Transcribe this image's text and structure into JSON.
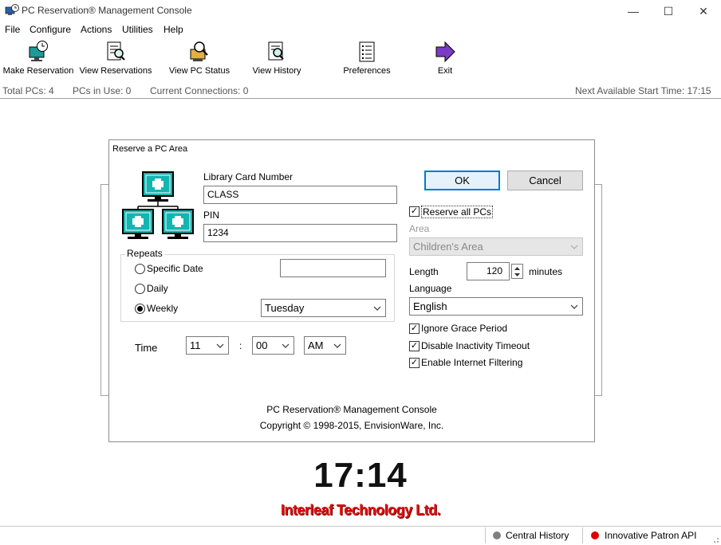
{
  "window": {
    "title": "PC Reservation® Management Console",
    "controls": {
      "minimize": "—",
      "maximize": "☐",
      "close": "✕"
    }
  },
  "menu": [
    "File",
    "Configure",
    "Actions",
    "Utilities",
    "Help"
  ],
  "toolbar": [
    {
      "label": "Make Reservation",
      "icon": "clock-computer-icon"
    },
    {
      "label": "View Reservations",
      "icon": "document-magnifier-icon"
    },
    {
      "label": "View PC Status",
      "icon": "computer-magnifier-icon"
    },
    {
      "label": "View History",
      "icon": "history-document-icon"
    },
    {
      "label": "Preferences",
      "icon": "list-document-icon"
    },
    {
      "label": "Exit",
      "icon": "exit-arrow-icon"
    }
  ],
  "status": {
    "total_pcs": "Total PCs: 4",
    "pcs_in_use": "PCs in Use: 0",
    "current_connections": "Current Connections: 0",
    "next_available": "Next Available Start Time: 17:15"
  },
  "dialog": {
    "title": "Reserve a PC Area",
    "card_label": "Library Card Number",
    "card_value": "CLASS",
    "pin_label": "PIN",
    "pin_value": "1234",
    "repeats": {
      "legend": "Repeats",
      "specific_date": "Specific Date",
      "specific_date_value": "",
      "daily": "Daily",
      "weekly": "Weekly",
      "selected": "weekly",
      "weekday": "Tuesday"
    },
    "time": {
      "label": "Time",
      "hour": "11",
      "separator": ":",
      "minute": "00",
      "ampm": "AM"
    },
    "ok": "OK",
    "cancel": "Cancel",
    "reserve_all": {
      "label": "Reserve all PCs",
      "checked": true
    },
    "area_label": "Area",
    "area_value": "Children's Area",
    "length_label": "Length",
    "length_value": "120",
    "length_unit": "minutes",
    "language_label": "Language",
    "language_value": "English",
    "options": [
      {
        "label": "Ignore Grace Period",
        "checked": true
      },
      {
        "label": "Disable Inactivity Timeout",
        "checked": true
      },
      {
        "label": "Enable Internet Filtering",
        "checked": true
      }
    ],
    "footer_line1": "PC Reservation® Management Console",
    "footer_line2": "Copyright © 1998-2015, EnvisionWare, Inc."
  },
  "clock": "17:14",
  "brand": "Interleaf Technology Ltd.",
  "statusbar": {
    "central_history": {
      "label": "Central History",
      "color": "#808080"
    },
    "patron_api": {
      "label": "Innovative Patron API",
      "color": "#e00000"
    }
  },
  "colors": {
    "teal": "#13b5b0",
    "focus_blue": "#0078d7",
    "brand_red": "#e01010"
  }
}
